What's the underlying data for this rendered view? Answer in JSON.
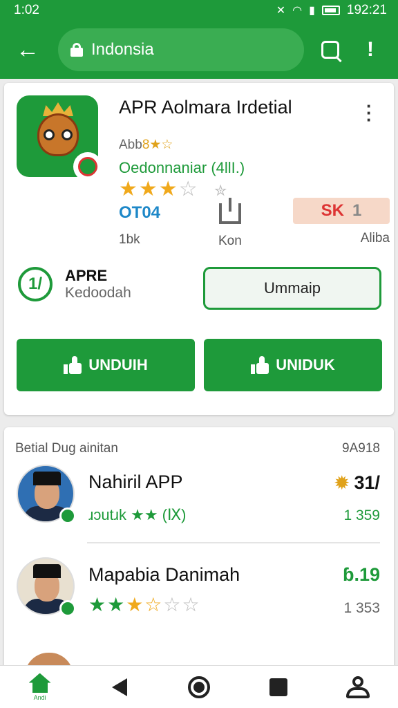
{
  "status": {
    "time": "1:02",
    "right": "192:21",
    "icons": [
      "mute-icon",
      "wifi-icon",
      "signal-icon",
      "battery-icon"
    ]
  },
  "appbar": {
    "search_text": "Indonsia",
    "back_icon": "arrow-left-icon",
    "search_icon": "search-icon",
    "alert_icon": "alert-icon"
  },
  "app": {
    "title": "APR Aolmara Irdetial",
    "sub": "Abb",
    "sub_rating": "8★☆",
    "developer": "Oedonnaniar (4llI.)",
    "stars_full": "★★★",
    "stars_empty": "☆",
    "stars_tail": "✮",
    "stat1_value": "OT04",
    "stat1_label": "1bk",
    "stat2_label": "Kon",
    "stat3_value": "SK",
    "stat3_num": "1",
    "stat3_label": "Aliba",
    "apre_title": "APRE",
    "apre_sub": "Kedoodah",
    "apre_icon_glyph": "1/",
    "outline_button": "Ummaip",
    "btn_left": "UNDUIH",
    "btn_right": "UNIDUK"
  },
  "list": {
    "header": "Betial Dug ainitan",
    "header_right": "9A918",
    "items": [
      {
        "title": "Nahiril APP",
        "sub": "ɹɔutɹk ★★ (Ⅸ)",
        "right_top": "31/",
        "right_bottom": "1 359"
      },
      {
        "title": "Mapabia Danimah",
        "right_top": "ɓ.19",
        "right_bottom": "1 353"
      }
    ],
    "item2_stars_green": "★★",
    "item2_stars_gold": "★☆",
    "item2_stars_empty": "☆☆"
  },
  "colors": {
    "primary": "#1e9a3a",
    "accent_gold": "#f0a91c",
    "link_blue": "#1e88c8"
  },
  "nav": {
    "home_label": "Andi"
  }
}
